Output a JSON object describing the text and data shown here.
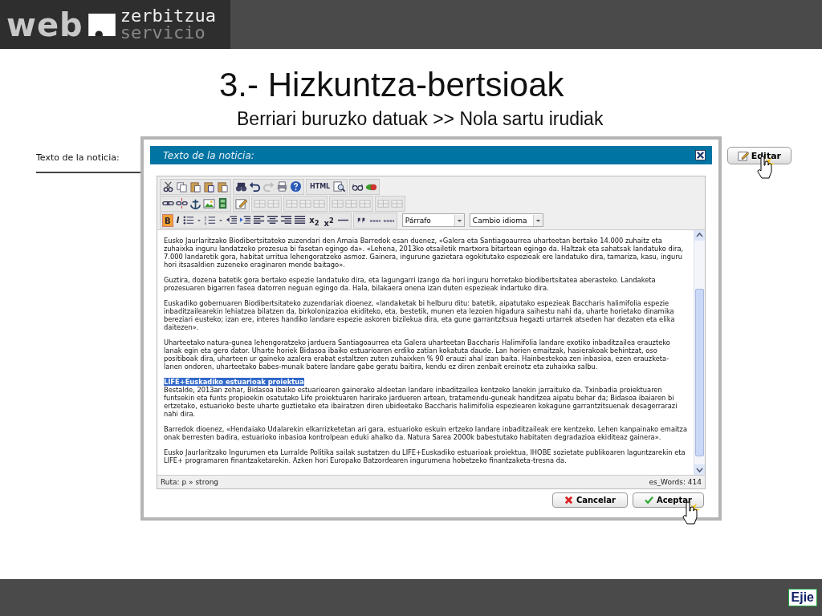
{
  "header": {
    "logo_word": "web",
    "logo_line_1": "zerbitzua",
    "logo_line_2": "servicio"
  },
  "title": "3.- Hizkuntza-bertsioak",
  "subtitle": "Berriari buruzko datuak >> Nola sartu irudiak",
  "page": {
    "field_label": "Texto de la noticia:",
    "edit_button": "Editar"
  },
  "dialog": {
    "title": "Texto de la noticia:",
    "toolbar": {
      "html": "HTML",
      "bold": {
        "label": "B",
        "active": true
      },
      "italic": {
        "label": "I",
        "active": false
      },
      "subscript": "x$_{2}$",
      "superscript": "x$^{2}$",
      "format_select": "Párrafo",
      "language_select": "Cambio idioma"
    },
    "paragraphs": [
      {
        "text": "Eusko Jaurlaritzako Biodibertsitateko zuzendari den Amaia Barredok esan duenez, «Galera eta Santiagoaurrea uharteetan bertako 14.000 zuhaitz eta zuhaixka inguru landatzeko prozesua bi fasetan egingo da». «Lehena, 2013ko otsailetik martxora bitartean egingo da. Haltzak eta sahatsak landatuko dira, 7.000 landaretik gora, habitat urritua lehengoratzeko asmoz. Gainera, ingurune gazietara egokitutako espezieak ere landatuko dira, tamariza, kasu, inguru hori itsasaldien zuzeneko eraginaren mende baitago»."
      },
      {
        "text": "Guztira, dozena batetik gora bertako espezie landatuko dira, eta lagungarri izango da hori inguru horretako biodibertsitatea aberasteko. Landaketa prozesuaren bigarren fasea datorren neguan egingo da. Hala, bilakaera onena izan duten espezieak indartuko dira."
      },
      {
        "text": "Euskadiko gobernuaren Biodibertsitateko zuzendariak dioenez, «landaketak bi helburu ditu: batetik, aipatutako espezieak Baccharis halimifolia espezie inbaditzailearekin lehiatzea bilatzen da, birkolonizazioa ekiditeko, eta, bestetik, munen eta lezoien higadura saihestu nahi da, uharte horietako dinamika bereziari eusteko; izan ere, interes handiko landare espezie askoren bizilekua dira, eta gune garrantzitsua hegazti urtarrek atseden har dezaten eta elika daitezen»."
      },
      {
        "text": "Uharteetako natura-gunea lehengoratzeko jarduera Santiagoaurrea eta Galera uharteetan Baccharis Halimifolia landare exotiko inbaditzailea erauzteko lanak egin eta gero dator. Uharte horiek Bidasoa ibaiko estuarioaren erdiko zatian kokatuta daude. Lan horien emaitzak, hasierakoak behintzat, oso positiboak dira, uharteen ur gaineko azalera erabat estaltzen zuten zuhaixken % 90 erauzi ahal izan baita. Hainbestekoa zen inbasioa, ezen erauzketa-lanen ondoren, uharteetako babes-munak batere landare gabe geratu baitira, kendu ez diren zenbait ereinotz eta zuhaixka salbu."
      },
      {
        "heading": {
          "text": "LIFE+Euskadiko estuarioak proiektua",
          "selected": true
        },
        "text": "Bestalde, 2013an zehar, Bidasoa ibaiko estuarioaren gainerako aldeetan landare inbaditzailea kentzeko lanekin jarraituko da. Txinbadia proiektuaren funtsekin eta funts propioekin osatutako Life proiektuaren harirako jardueren artean, tratamendu-guneak handitzea aipatu behar da; Bidasoa ibaiaren bi ertzetako, estuarioko beste uharte guztietako eta ibairatzen diren ubideetako Baccharis halimifolia espeziearen kokagune garrantzitsuenak desagerrarazi nahi dira."
      },
      {
        "text": "Barredok dioenez, «Hendaiako Udalarekin elkarrizketetan ari gara, estuarioko eskuin ertzeko landare inbaditzaileak ere kentzeko. Lehen kanpainako emaitza onak berresten badira, estuarioko inbasioa kontrolpean eduki ahalko da. Natura Sarea 2000k babestutako habitaten degradazioa ekiditeaz gainera»."
      },
      {
        "text": "Eusko Jaurlaritzako Ingurumen eta Lurralde Politika sailak sustatzen du LIFE+Euskadiko estuarioak proiektua, IHOBE sozietate publikoaren laguntzarekin eta LIFE+ programaren finantzaketarekin. Azken hori Europako Batzordearen ingurumena hobetzeko finantzaketa-tresna da."
      }
    ],
    "path": "Ruta: p » strong",
    "word_count": "es_Words: 414",
    "cancel_button": "Cancelar",
    "accept_button": "Aceptar"
  },
  "footer": {
    "logo": "Ejie"
  }
}
